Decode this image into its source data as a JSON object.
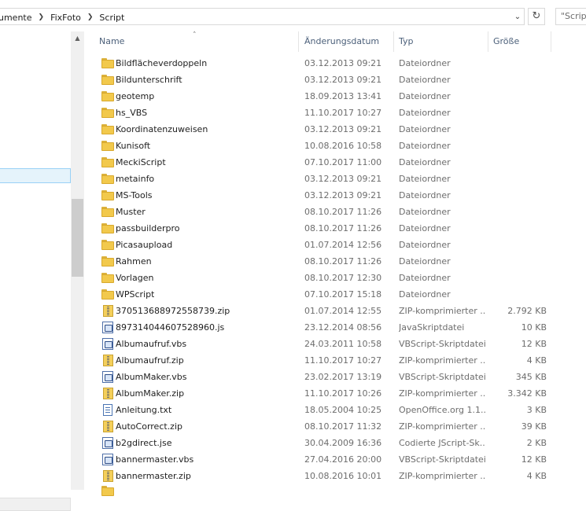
{
  "breadcrumb": {
    "items": [
      "umente",
      "FixFoto",
      "Script"
    ]
  },
  "search": {
    "placeholder": "\"Scrip"
  },
  "columns": {
    "name": "Name",
    "date": "Änderungsdatum",
    "type": "Typ",
    "size": "Größe"
  },
  "files": [
    {
      "icon": "folder-icon",
      "name": "Bildflächeverdoppeln",
      "date": "03.12.2013 09:21",
      "type": "Dateiordner",
      "size": ""
    },
    {
      "icon": "folder-icon",
      "name": "Bildunterschrift",
      "date": "03.12.2013 09:21",
      "type": "Dateiordner",
      "size": ""
    },
    {
      "icon": "folder-icon",
      "name": "geotemp",
      "date": "18.09.2013 13:41",
      "type": "Dateiordner",
      "size": ""
    },
    {
      "icon": "folder-icon",
      "name": "hs_VBS",
      "date": "11.10.2017 10:27",
      "type": "Dateiordner",
      "size": ""
    },
    {
      "icon": "folder-icon",
      "name": "Koordinatenzuweisen",
      "date": "03.12.2013 09:21",
      "type": "Dateiordner",
      "size": ""
    },
    {
      "icon": "folder-icon",
      "name": "Kunisoft",
      "date": "10.08.2016 10:58",
      "type": "Dateiordner",
      "size": ""
    },
    {
      "icon": "folder-icon",
      "name": "MeckiScript",
      "date": "07.10.2017 11:00",
      "type": "Dateiordner",
      "size": ""
    },
    {
      "icon": "folder-icon",
      "name": "metainfo",
      "date": "03.12.2013 09:21",
      "type": "Dateiordner",
      "size": ""
    },
    {
      "icon": "folder-icon",
      "name": "MS-Tools",
      "date": "03.12.2013 09:21",
      "type": "Dateiordner",
      "size": ""
    },
    {
      "icon": "folder-icon",
      "name": "Muster",
      "date": "08.10.2017 11:26",
      "type": "Dateiordner",
      "size": ""
    },
    {
      "icon": "folder-icon",
      "name": "passbuilderpro",
      "date": "08.10.2017 11:26",
      "type": "Dateiordner",
      "size": ""
    },
    {
      "icon": "folder-icon",
      "name": "Picasaupload",
      "date": "01.07.2014 12:56",
      "type": "Dateiordner",
      "size": ""
    },
    {
      "icon": "folder-icon",
      "name": "Rahmen",
      "date": "08.10.2017 11:26",
      "type": "Dateiordner",
      "size": ""
    },
    {
      "icon": "folder-icon",
      "name": "Vorlagen",
      "date": "08.10.2017 12:30",
      "type": "Dateiordner",
      "size": ""
    },
    {
      "icon": "folder-icon",
      "name": "WPScript",
      "date": "07.10.2017 15:18",
      "type": "Dateiordner",
      "size": ""
    },
    {
      "icon": "zip-file-icon",
      "name": "370513688972558739.zip",
      "date": "01.07.2014 12:55",
      "type": "ZIP-komprimierter ...",
      "size": "2.792 KB"
    },
    {
      "icon": "script-file-icon",
      "name": "897314044607528960.js",
      "date": "23.12.2014 08:56",
      "type": "JavaSkriptdatei",
      "size": "10 KB"
    },
    {
      "icon": "script-file-icon",
      "name": "Albumaufruf.vbs",
      "date": "24.03.2011 10:58",
      "type": "VBScript-Skriptdatei",
      "size": "12 KB"
    },
    {
      "icon": "zip-file-icon",
      "name": "Albumaufruf.zip",
      "date": "11.10.2017 10:27",
      "type": "ZIP-komprimierter ...",
      "size": "4 KB"
    },
    {
      "icon": "script-file-icon",
      "name": "AlbumMaker.vbs",
      "date": "23.02.2017 13:19",
      "type": "VBScript-Skriptdatei",
      "size": "345 KB"
    },
    {
      "icon": "zip-file-icon",
      "name": "AlbumMaker.zip",
      "date": "11.10.2017 10:26",
      "type": "ZIP-komprimierter ...",
      "size": "3.342 KB"
    },
    {
      "icon": "text-file-icon",
      "name": "Anleitung.txt",
      "date": "18.05.2004 10:25",
      "type": "OpenOffice.org 1.1....",
      "size": "3 KB"
    },
    {
      "icon": "zip-file-icon",
      "name": "AutoCorrect.zip",
      "date": "08.10.2017 11:32",
      "type": "ZIP-komprimierter ...",
      "size": "39 KB"
    },
    {
      "icon": "script-file-icon",
      "name": "b2gdirect.jse",
      "date": "30.04.2009 16:36",
      "type": "Codierte JScript-Sk...",
      "size": "2 KB"
    },
    {
      "icon": "script-file-icon",
      "name": "bannermaster.vbs",
      "date": "27.04.2016 20:00",
      "type": "VBScript-Skriptdatei",
      "size": "12 KB"
    },
    {
      "icon": "zip-file-icon",
      "name": "bannermaster.zip",
      "date": "10.08.2016 10:01",
      "type": "ZIP-komprimierter ...",
      "size": "4 KB"
    }
  ]
}
